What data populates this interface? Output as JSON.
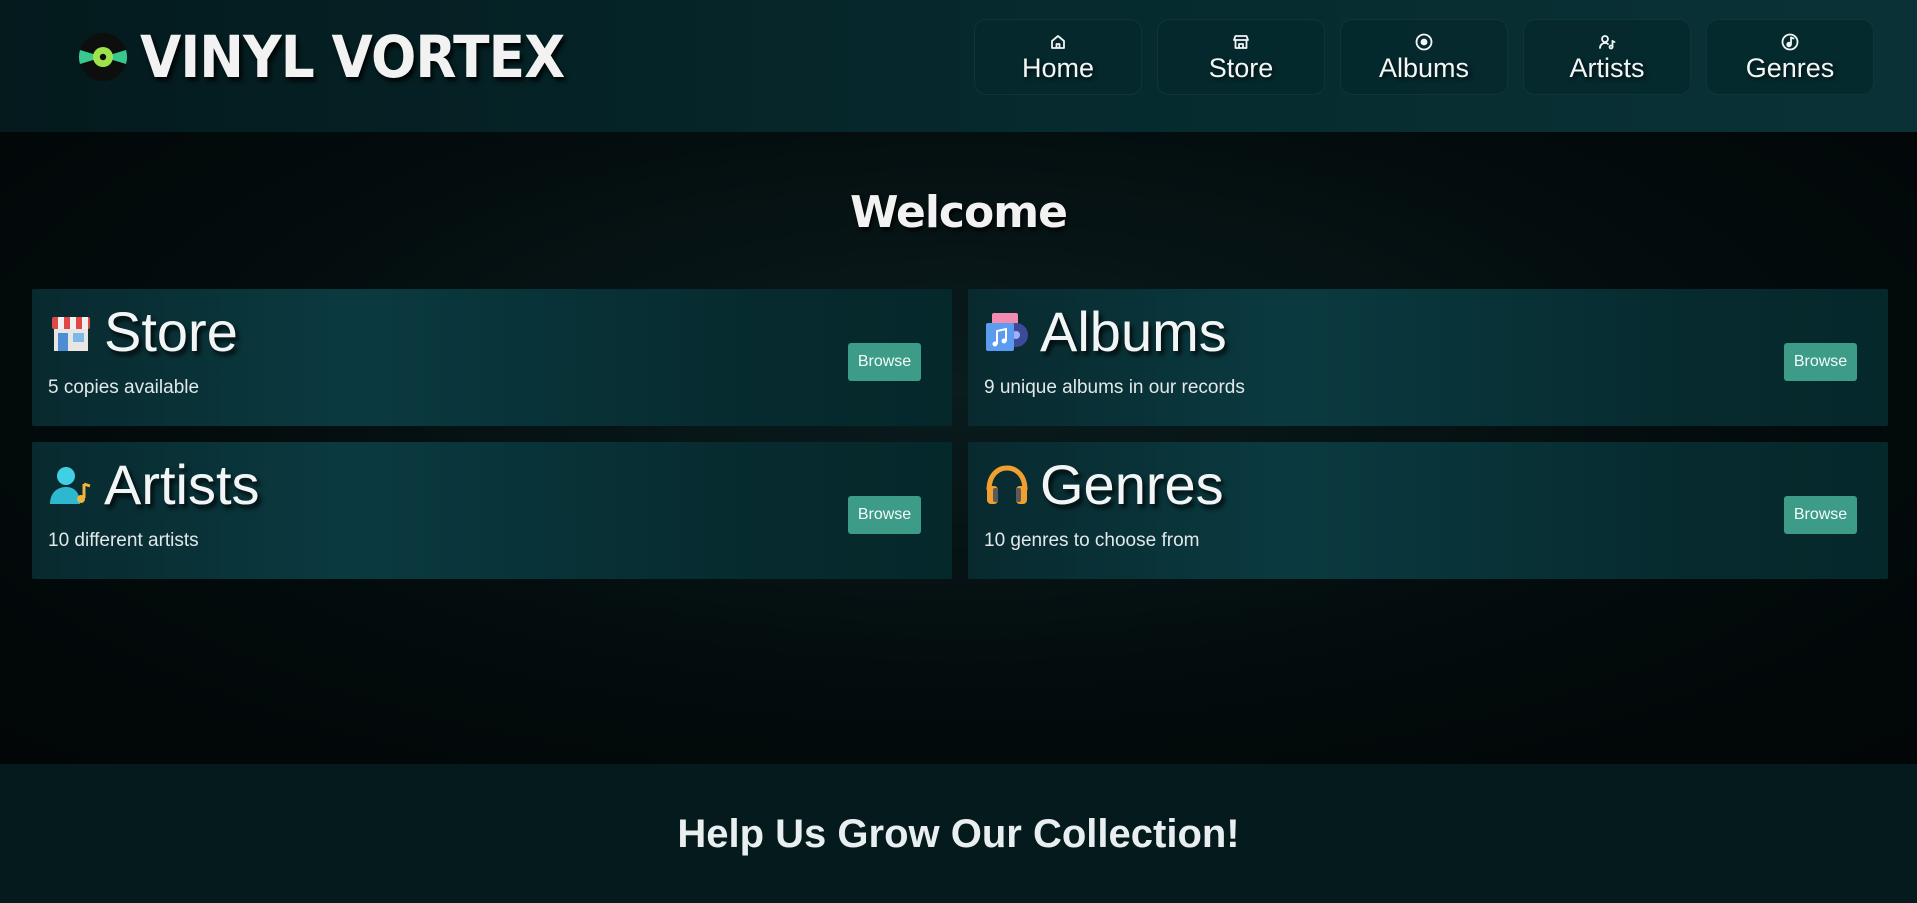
{
  "brand": {
    "name": "VINYL VORTEX",
    "logo_icon": "vinyl-record-icon"
  },
  "nav": [
    {
      "label": "Home",
      "icon": "home-icon"
    },
    {
      "label": "Store",
      "icon": "store-icon"
    },
    {
      "label": "Albums",
      "icon": "disc-icon"
    },
    {
      "label": "Artists",
      "icon": "user-music-icon"
    },
    {
      "label": "Genres",
      "icon": "music-note-icon"
    }
  ],
  "main": {
    "heading": "Welcome",
    "cards": [
      {
        "title": "Store",
        "description": "5 copies available",
        "button": "Browse",
        "icon": "store-emoji-icon"
      },
      {
        "title": "Albums",
        "description": "9 unique albums in our records",
        "button": "Browse",
        "icon": "albums-emoji-icon"
      },
      {
        "title": "Artists",
        "description": "10 different artists",
        "button": "Browse",
        "icon": "artist-emoji-icon"
      },
      {
        "title": "Genres",
        "description": "10 genres to choose from",
        "button": "Browse",
        "icon": "headphones-emoji-icon"
      }
    ]
  },
  "footer": {
    "heading": "Help Us Grow Our Collection!"
  },
  "colors": {
    "accent": "#3c9c88",
    "header_bg": "#062a2e",
    "card_bg": "#0a3a40",
    "page_bg": "#020a0b"
  }
}
